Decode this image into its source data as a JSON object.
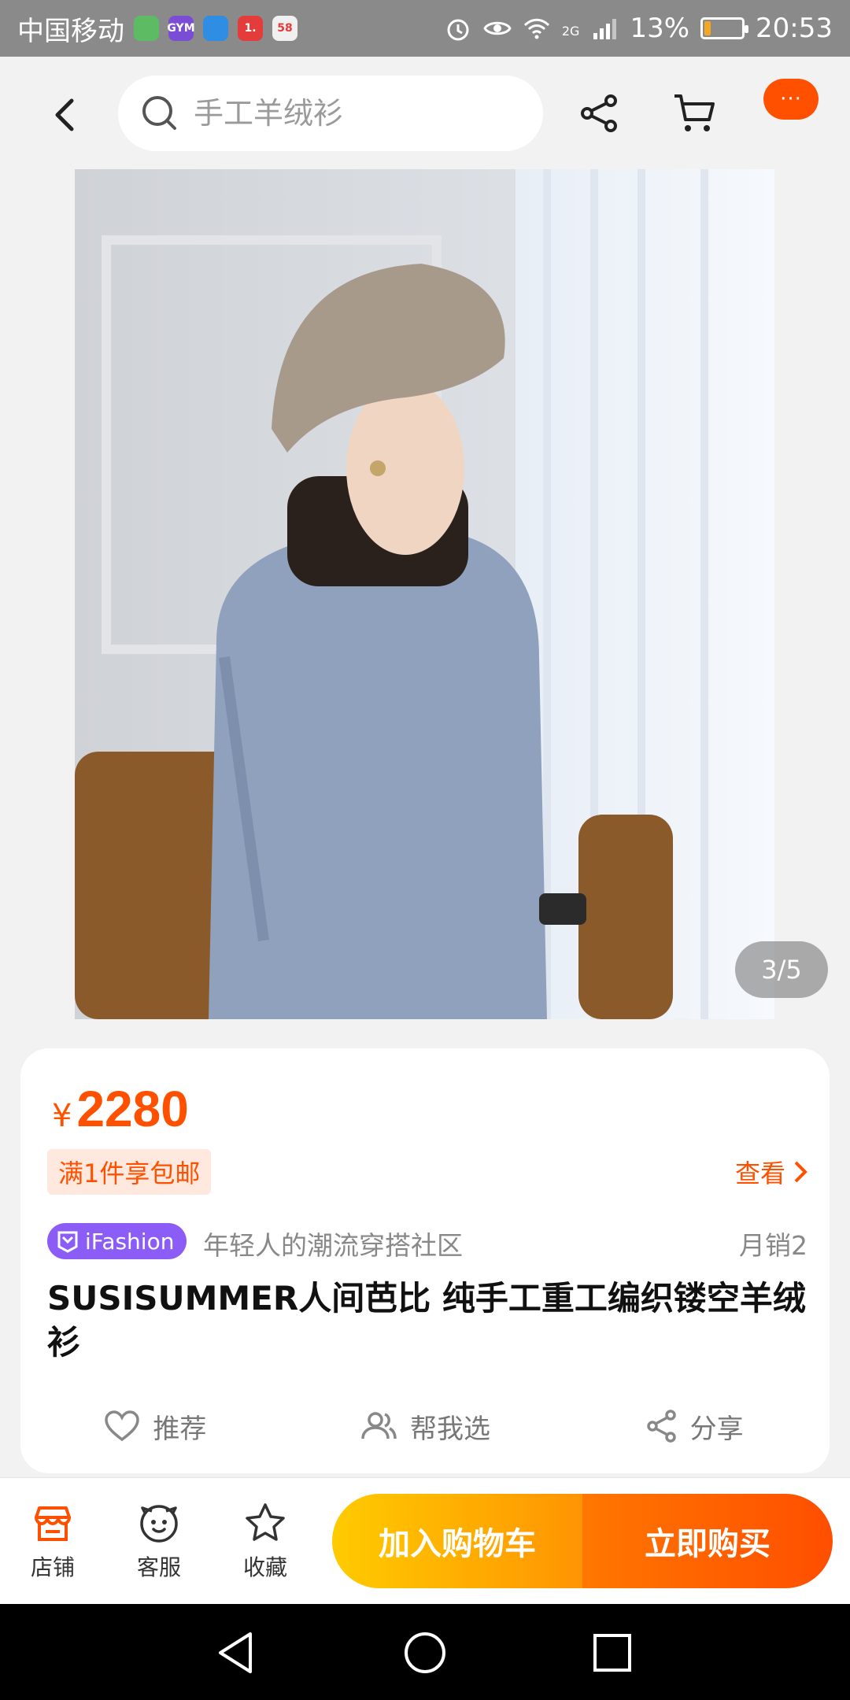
{
  "status_bar": {
    "carrier": "中国移动",
    "apps": [
      {
        "name": "wechat-app-icon",
        "color": "#5dbb63",
        "label": ""
      },
      {
        "name": "gym-app-icon",
        "color": "#7b4dd6",
        "label": "GYM"
      },
      {
        "name": "blue-app-icon",
        "color": "#2f8de4",
        "label": ""
      },
      {
        "name": "red-app-icon",
        "color": "#e43b3b",
        "label": "1."
      },
      {
        "name": "58-app-icon",
        "color": "#f0f0f0",
        "label": "58"
      }
    ],
    "network": "2G",
    "battery": "13%",
    "time": "20:53"
  },
  "header": {
    "search_placeholder": "手工羊绒衫",
    "more_label": "···",
    "more_color": "#ff5000"
  },
  "gallery": {
    "page_indicator": "3/5"
  },
  "product": {
    "currency": "¥",
    "price": "2280",
    "shipping_tag": "满1件享包邮",
    "view_link": "查看",
    "badge_label": "iFashion",
    "community_text": "年轻人的潮流穿搭社区",
    "monthly_sales": "月销2",
    "title": "SUSISUMMER人间芭比 纯手工重工编织镂空羊绒衫",
    "accent_color": "#ff5000"
  },
  "actions": [
    {
      "label": "推荐",
      "icon": "heart-icon"
    },
    {
      "label": "帮我选",
      "icon": "people-icon"
    },
    {
      "label": "分享",
      "icon": "share-icon"
    }
  ],
  "bottom_bar": {
    "tabs": [
      {
        "label": "店铺",
        "icon": "store-icon"
      },
      {
        "label": "客服",
        "icon": "customer-service-icon"
      },
      {
        "label": "收藏",
        "icon": "star-icon"
      }
    ],
    "add_to_cart": "加入购物车",
    "buy_now": "立即购买"
  }
}
